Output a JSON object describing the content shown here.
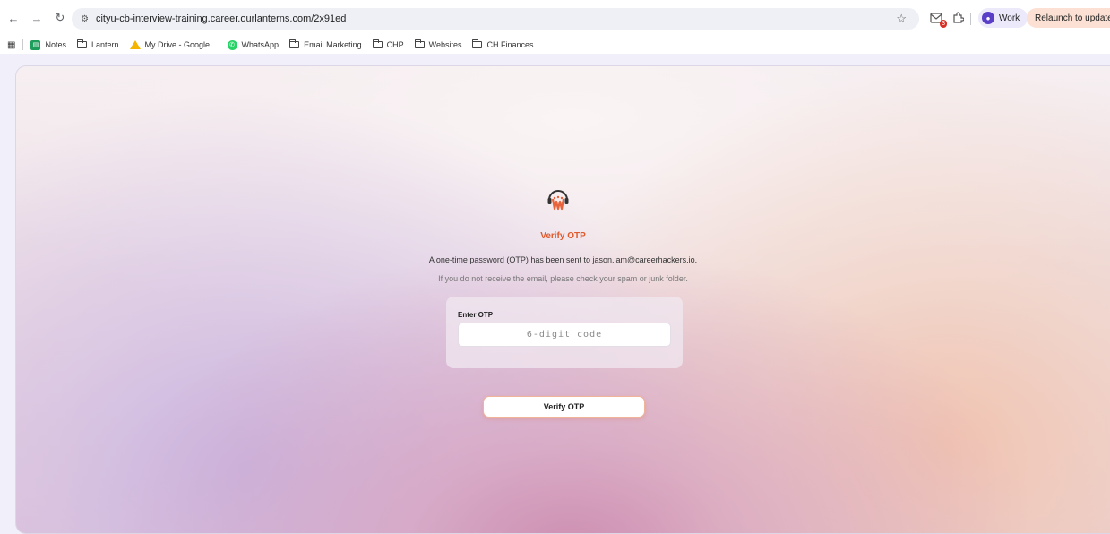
{
  "browser": {
    "url": "cityu-cb-interview-training.career.ourlanterns.com/2x91ed",
    "extension_badge": "3",
    "profile_label": "Work",
    "relaunch_label": "Relaunch to update"
  },
  "bookmarks": {
    "items": [
      {
        "label": "Notes"
      },
      {
        "label": "Lantern"
      },
      {
        "label": "My Drive - Google..."
      },
      {
        "label": "WhatsApp"
      },
      {
        "label": "Email Marketing"
      },
      {
        "label": "CHP"
      },
      {
        "label": "Websites"
      },
      {
        "label": "CH Finances"
      }
    ]
  },
  "page": {
    "title": "Verify OTP",
    "sent_message": "A one-time password (OTP) has been sent to jason.lam@careerhackers.io.",
    "hint_message": "If you do not receive the email, please check your spam or junk folder.",
    "otp_label": "Enter OTP",
    "otp_placeholder": "6-digit code",
    "otp_value": "",
    "verify_button": "Verify OTP"
  },
  "colors": {
    "accent": "#e05a2b",
    "button_border": "#f0b49a",
    "profile_bg": "#ece9fb",
    "relaunch_bg": "#fbe0d3"
  }
}
